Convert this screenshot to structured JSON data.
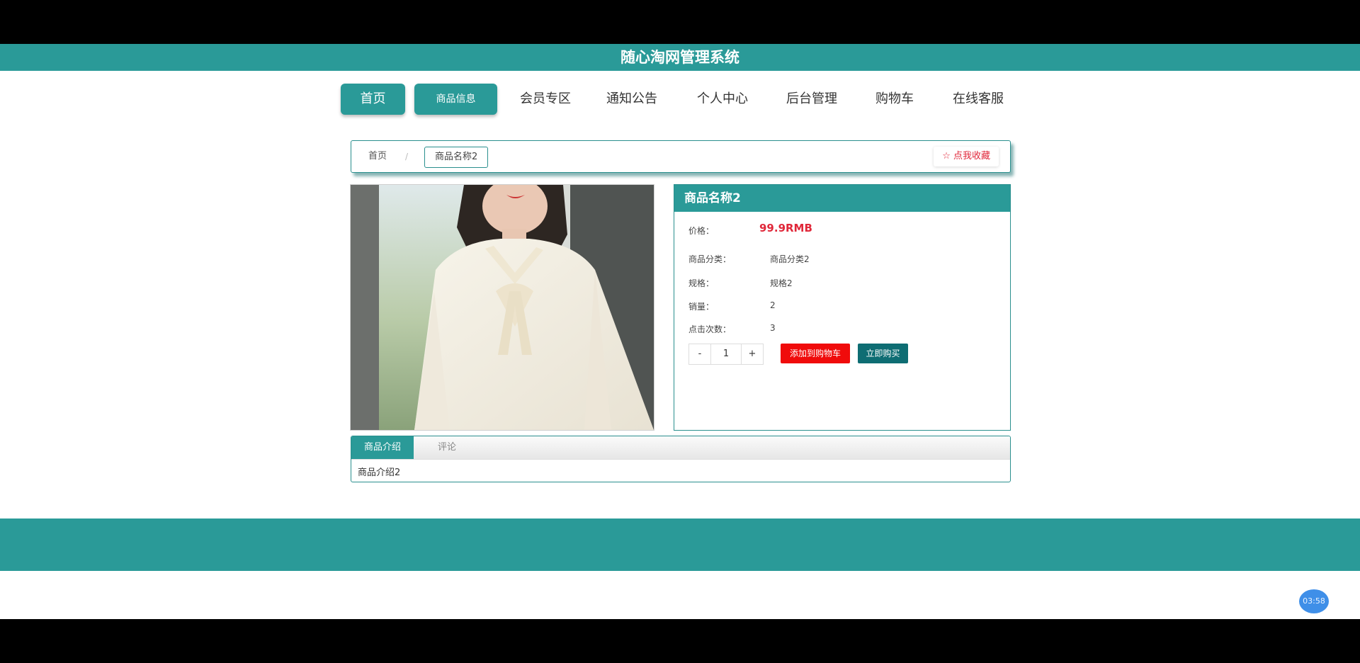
{
  "header": {
    "title": "随心淘网管理系统"
  },
  "nav": {
    "items": [
      {
        "label": "首页"
      },
      {
        "label": "商品信息"
      },
      {
        "label": "会员专区"
      },
      {
        "label": "通知公告"
      },
      {
        "label": "个人中心"
      },
      {
        "label": "后台管理"
      },
      {
        "label": "购物车"
      },
      {
        "label": "在线客服"
      }
    ]
  },
  "breadcrumb": {
    "home": "首页",
    "separator": "/",
    "current": "商品名称2",
    "favorite_label": "☆ 点我收藏"
  },
  "product": {
    "name": "商品名称2",
    "price_label": "价格：",
    "price": "99.9RMB",
    "fields": [
      {
        "label": "商品分类：",
        "value": "商品分类2"
      },
      {
        "label": "规格：",
        "value": "规格2"
      },
      {
        "label": "销量：",
        "value": "2"
      },
      {
        "label": "点击次数：",
        "value": "3"
      }
    ],
    "quantity": {
      "minus": "-",
      "value": "1",
      "plus": "+"
    },
    "add_to_cart_label": "添加到购物车",
    "buy_now_label": "立即购买"
  },
  "tabs": {
    "items": [
      {
        "label": "商品介绍"
      },
      {
        "label": "评论"
      }
    ],
    "content": "商品介绍2"
  },
  "recording": {
    "timer": "03:58"
  },
  "colors": {
    "primary": "#2a9a98",
    "price": "#e0283a",
    "cart_button": "#f00b0b",
    "buy_button": "#0e6d73"
  }
}
